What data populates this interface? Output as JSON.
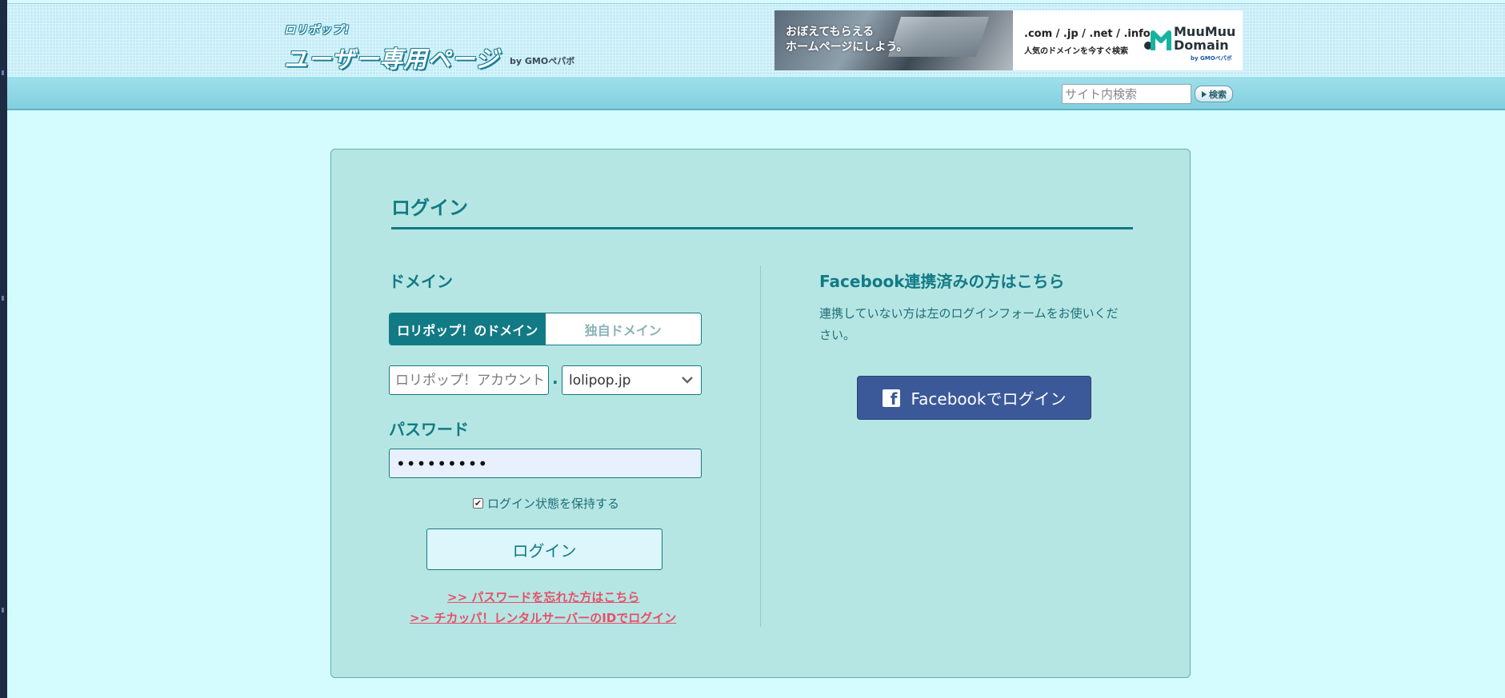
{
  "header": {
    "logo_small": "ロリポップ!",
    "logo_big": "ユーザー専用ページ",
    "logo_by": "by GMOペパボ",
    "banner": {
      "photo_line1": "おぼえてもらえる",
      "photo_line2": "ホームページにしよう。",
      "tlds": ".com / .jp / .net / .info",
      "tagline": "人気のドメインを今すぐ検索",
      "brand_line1": "MuuMuu",
      "brand_line2": "Domain",
      "brand_by": "by GMOペパボ"
    }
  },
  "nav": {
    "search_placeholder": "サイト内検索",
    "search_button": "検索"
  },
  "login": {
    "title": "ログイン",
    "domain_label": "ドメイン",
    "tab_lolipop": "ロリポップ！のドメイン",
    "tab_own": "独自ドメイン",
    "account_placeholder": "ロリポップ！アカウント",
    "separator": ".",
    "domain_selected": "lolipop.jp",
    "password_label": "パスワード",
    "password_value": "•••••••••",
    "remember_label": "ログイン状態を保持する",
    "remember_checked": true,
    "login_button": "ログイン",
    "forgot_link": ">> パスワードを忘れた方はこちら",
    "chicappa_link": ">> チカッパ！レンタルサーバーのIDでログイン"
  },
  "facebook": {
    "heading": "Facebook連携済みの方はこちら",
    "note": "連携していない方は左のログインフォームをお使いください。",
    "button": "Facebookでログイン",
    "button_color": "#3b5998"
  },
  "colors": {
    "accent": "#117a85",
    "panel_bg": "#b6e6e3",
    "page_bg": "#d4fbfd",
    "link": "#e5506a"
  }
}
